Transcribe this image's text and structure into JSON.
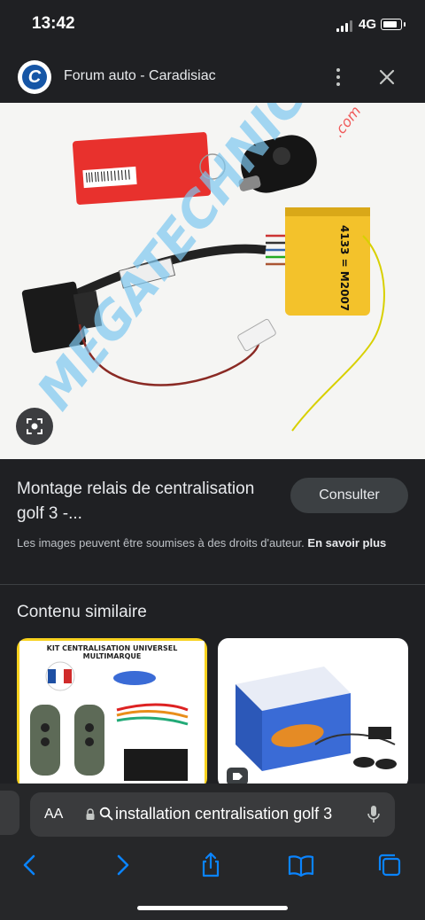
{
  "status_bar": {
    "time": "13:42",
    "network": "4G",
    "battery_level": 0.85
  },
  "header": {
    "site_title": "Forum auto - Caradisiac",
    "logo_letter": "C"
  },
  "image": {
    "watermark": "MEGATECHNIC",
    "watermark_suffix": ".com",
    "module_label": "4133 = M2007"
  },
  "result": {
    "title": "Montage relais de centralisation golf 3 -...",
    "consult_label": "Consulter",
    "copyright_text": "Les images peuvent être soumises à des droits d'auteur.",
    "learn_more": "En savoir plus"
  },
  "similar": {
    "heading": "Contenu similaire",
    "cards": [
      {
        "caption": "KIT CENTRALISATION UNIVERSEL MULTIMARQUE"
      },
      {
        "caption": ""
      }
    ]
  },
  "browser": {
    "aa_label": "AA",
    "address_text": "installation centralisation golf 3"
  },
  "icons": {
    "more": "more-vert-icon",
    "close": "close-icon",
    "lens": "lens-icon",
    "lock": "lock-icon",
    "search": "search-icon",
    "mic": "mic-icon",
    "back": "chevron-left-icon",
    "forward": "chevron-right-icon",
    "share": "share-icon",
    "bookmarks": "book-icon",
    "tabs": "tabs-icon"
  },
  "colors": {
    "background": "#1f2023",
    "toolbar": "#262729",
    "accent_link": "#0a84ff",
    "card_border": "#f8d21e"
  }
}
